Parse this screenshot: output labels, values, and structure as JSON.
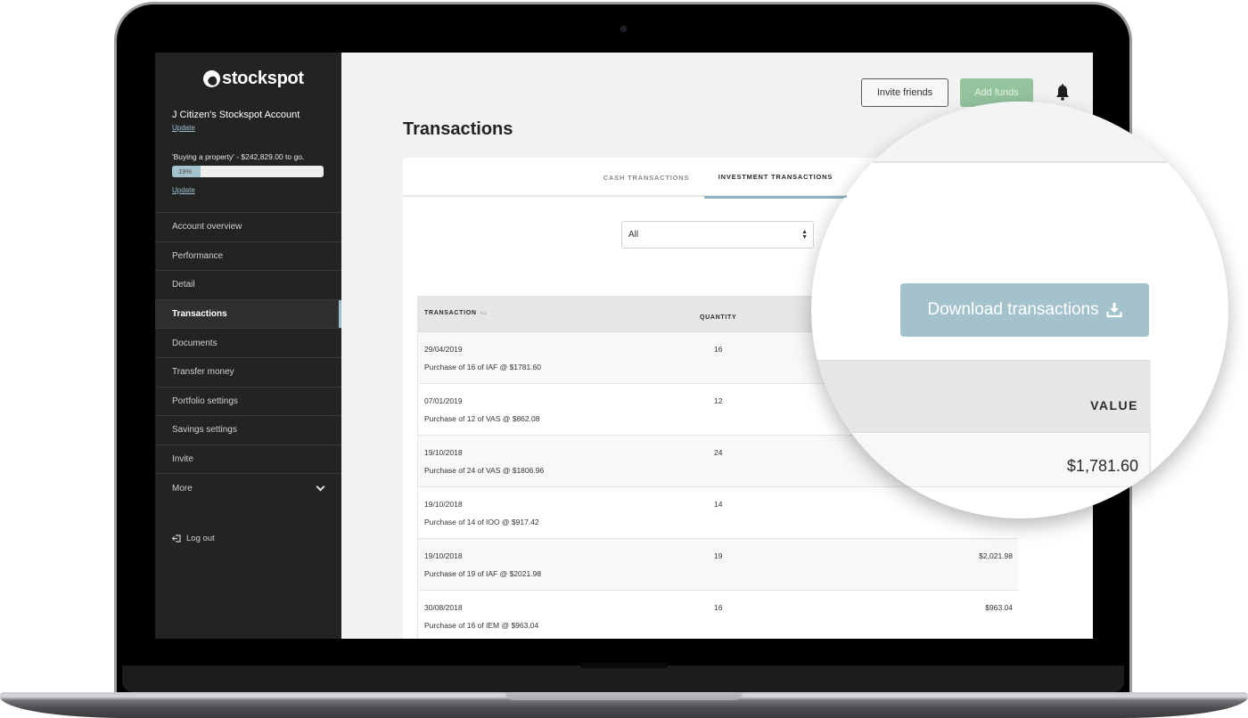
{
  "brand": {
    "name": "stockspot"
  },
  "account": {
    "title": "J Citizen's Stockspot Account",
    "update_label": "Update",
    "goal_text": "'Buying a property' - $242,829.00 to go.",
    "goal_progress_label": "19%",
    "goal_progress_percent": 19,
    "goal_update_label": "Update"
  },
  "sidebar": {
    "items": [
      {
        "label": "Account overview"
      },
      {
        "label": "Performance"
      },
      {
        "label": "Detail"
      },
      {
        "label": "Transactions",
        "active": true
      },
      {
        "label": "Documents"
      },
      {
        "label": "Transfer money"
      },
      {
        "label": "Portfolio settings"
      },
      {
        "label": "Savings settings"
      },
      {
        "label": "Invite"
      },
      {
        "label": "More"
      }
    ],
    "logout_label": "Log out"
  },
  "header": {
    "invite_label": "Invite friends",
    "add_funds_label": "Add funds"
  },
  "page": {
    "title": "Transactions"
  },
  "tabs": [
    {
      "label": "CASH TRANSACTIONS"
    },
    {
      "label": "INVESTMENT TRANSACTIONS",
      "active": true
    }
  ],
  "filter": {
    "selected": "All"
  },
  "download": {
    "label": "Download transactions"
  },
  "table": {
    "columns": {
      "transaction": "TRANSACTION",
      "quantity": "QUANTITY",
      "value": "VALUE"
    },
    "rows": [
      {
        "date": "29/04/2019",
        "desc": "Purchase of 16 of IAF @ $1781.60",
        "qty": "16",
        "value": "$1,781.60"
      },
      {
        "date": "07/01/2019",
        "desc": "Purchase of 12 of VAS @ $862.08",
        "qty": "12",
        "value": ""
      },
      {
        "date": "19/10/2018",
        "desc": "Purchase of 24 of VAS @ $1806.96",
        "qty": "24",
        "value": ""
      },
      {
        "date": "19/10/2018",
        "desc": "Purchase of 14 of IOO @ $917.42",
        "qty": "14",
        "value": ""
      },
      {
        "date": "19/10/2018",
        "desc": "Purchase of 19 of IAF @ $2021.98",
        "qty": "19",
        "value": "$2,021.98"
      },
      {
        "date": "30/08/2018",
        "desc": "Purchase of 16 of IEM @ $963.04",
        "qty": "16",
        "value": "$963.04"
      }
    ]
  },
  "colors": {
    "accent": "#a3c2cc",
    "add_funds": "#93c49e",
    "sidebar_bg": "#232323"
  }
}
